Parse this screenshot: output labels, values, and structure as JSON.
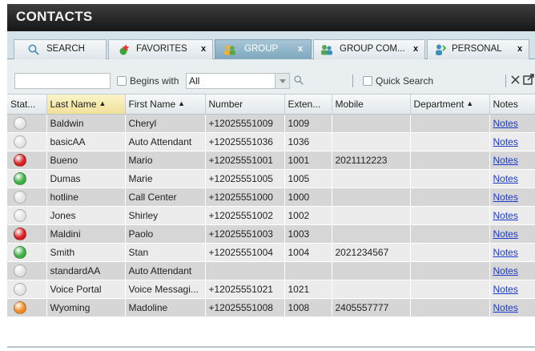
{
  "window": {
    "title": "CONTACTS"
  },
  "tabs": [
    {
      "label": "SEARCH",
      "icon": "search-icon",
      "closable": false,
      "active": false,
      "close_label": ""
    },
    {
      "label": "FAVORITES",
      "icon": "favorites-icon",
      "closable": true,
      "active": false,
      "close_label": "x"
    },
    {
      "label": "GROUP",
      "icon": "group-icon",
      "closable": true,
      "active": true,
      "close_label": "x"
    },
    {
      "label": "GROUP COM...",
      "icon": "group-common-icon",
      "closable": true,
      "active": false,
      "close_label": "x"
    },
    {
      "label": "PERSONAL",
      "icon": "personal-icon",
      "closable": true,
      "active": false,
      "close_label": "x"
    }
  ],
  "toolbar": {
    "filter_value": "",
    "begins_with_label": "Begins with",
    "field_selected": "All",
    "quick_search_label": "Quick Search"
  },
  "table": {
    "columns": [
      "Stat...",
      "Last Name",
      "First Name",
      "Number",
      "Exten...",
      "Mobile",
      "Department",
      "Notes"
    ],
    "rows": [
      {
        "status": "offline",
        "last": "Baldwin",
        "first": "Cheryl",
        "number": "+12025551009",
        "ext": "1009",
        "mobile": "",
        "dept": "",
        "notes": "Notes"
      },
      {
        "status": "offline",
        "last": "basicAA",
        "first": "Auto Attendant",
        "number": "+12025551036",
        "ext": "1036",
        "mobile": "",
        "dept": "",
        "notes": "Notes"
      },
      {
        "status": "busy",
        "last": "Bueno",
        "first": "Mario",
        "number": "+12025551001",
        "ext": "1001",
        "mobile": "2021112223",
        "dept": "",
        "notes": "Notes"
      },
      {
        "status": "available",
        "last": "Dumas",
        "first": "Marie",
        "number": "+12025551005",
        "ext": "1005",
        "mobile": "",
        "dept": "",
        "notes": "Notes"
      },
      {
        "status": "offline",
        "last": "hotline",
        "first": "Call Center",
        "number": "+12025551000",
        "ext": "1000",
        "mobile": "",
        "dept": "",
        "notes": "Notes"
      },
      {
        "status": "offline",
        "last": "Jones",
        "first": "Shirley",
        "number": "+12025551002",
        "ext": "1002",
        "mobile": "",
        "dept": "",
        "notes": "Notes"
      },
      {
        "status": "busy",
        "last": "Maldini",
        "first": "Paolo",
        "number": "+12025551003",
        "ext": "1003",
        "mobile": "",
        "dept": "",
        "notes": "Notes"
      },
      {
        "status": "available",
        "last": "Smith",
        "first": "Stan",
        "number": "+12025551004",
        "ext": "1004",
        "mobile": "2021234567",
        "dept": "",
        "notes": "Notes"
      },
      {
        "status": "offline",
        "last": "standardAA",
        "first": "Auto Attendant",
        "number": "",
        "ext": "",
        "mobile": "",
        "dept": "",
        "notes": "Notes"
      },
      {
        "status": "offline",
        "last": "Voice Portal",
        "first": "Voice Messagi...",
        "number": "+12025551021",
        "ext": "1021",
        "mobile": "",
        "dept": "",
        "notes": "Notes"
      },
      {
        "status": "away",
        "last": "Wyoming",
        "first": "Madoline",
        "number": "+12025551008",
        "ext": "1008",
        "mobile": "2405557777",
        "dept": "",
        "notes": "Notes"
      }
    ]
  },
  "colors": {
    "title_bar": "#1f1f1f",
    "active_tab": "#8fb5c9",
    "sorted_header": "#f3e6a8",
    "status_available": "#3cb043",
    "status_busy": "#d61f1f",
    "status_away": "#f08a24",
    "status_offline": "#e4e4e4",
    "link": "#1a3acc"
  }
}
